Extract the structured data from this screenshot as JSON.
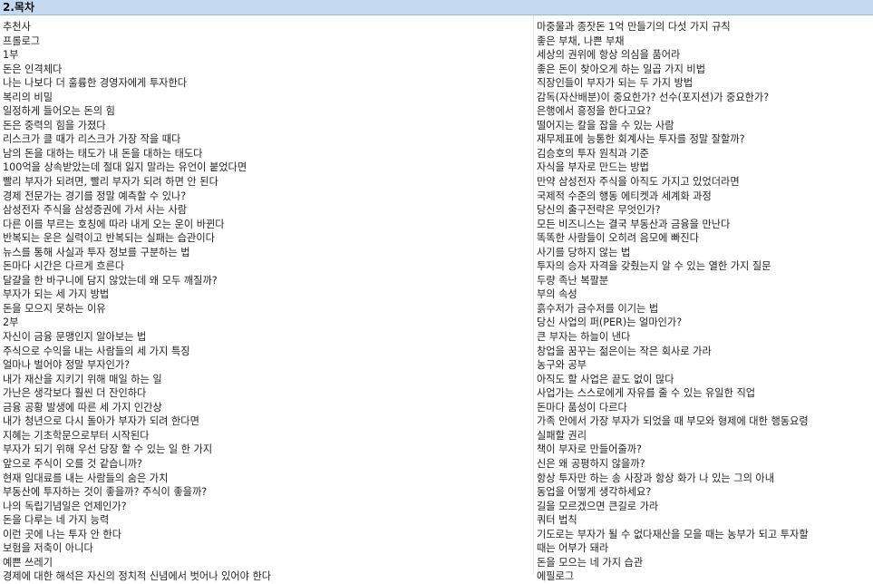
{
  "header": {
    "title": "2.목차"
  },
  "left_items": [
    "추천사",
    "프롤로그",
    "1부",
    "돈은 인격체다",
    "나는 나보다 더 훌륭한 경영자에게 투자한다",
    "복리의 비밀",
    "일정하게 들어오는 돈의 힘",
    "돈은 중력의 힘을 가졌다",
    "리스크가 클 때가 리스크가 가장 작을 때다",
    "남의 돈을 대하는 태도가 내 돈을 대하는 태도다",
    "100억을 상속받았는데 절대 잃지 말라는 유언이 붙었다면",
    "빨리 부자가 되려면, 빨리 부자가 되려 하면 안 된다",
    "경제 전문가는 경기를 정말 예측할 수 있나?",
    "삼성전자 주식을 삼성증권에 가서 사는 사람",
    "다른 이를 부르는 호칭에 따라 내게 오는 운이 바뀐다",
    "반복되는 운은 실력이고 반복되는 실패는 습관이다",
    "뉴스를 통해 사실과 투자 정보를 구분하는 법",
    "돈마다 시간은 다르게 흐른다",
    "달걀을 한 바구니에 담지 않았는데 왜 모두 깨질까?",
    "부자가 되는 세 가지 방법",
    "돈을 모으지 못하는 이유",
    "2부",
    "자신이 금융 문맹인지 알아보는 법",
    "주식으로 수익을 내는 사람들의 세 가지 특징",
    "얼마나 벌어야 정말 부자인가?",
    "내가 재산을 지키기 위해 매일 하는 일",
    "가난은 생각보다 훨씬 더 잔인하다",
    "금융 공황 발생에 따른 세 가지 인간상",
    "내가 청년으로 다시 돌아가 부자가 되려 한다면",
    "지혜는 기초학문으로부터 시작된다",
    "부자가 되기 위해 우선 당장 할 수 있는 일 한 가지",
    "앞으로 주식이 오를 것 같습니까?",
    "현재 임대료를 내는 사람들의 숨은 가치",
    "부동산에 투자하는 것이 좋을까? 주식이 좋을까?",
    "나의 독립기념일은 언제인가?",
    "돈을 다루는 네 가지 능력",
    "이런 곳에 나는 투자 안 한다",
    "보험을 저축이 아니다",
    "예쁜 쓰레기",
    "경제에 대한 해석은 자신의 정치적 신념에서 벗어나 있어야 한다"
  ],
  "right_items": [
    "마중물과 종잣돈 1억 만들기의 다섯 가지 규칙",
    "좋은 부채, 나쁜 부채",
    "세상의 권위에 항상 의심을 품어라",
    "좋은 돈이 찾아오게 하는 일곱 가지 비법",
    "직장인들이 부자가 되는 두 가지 방법",
    "감독(자산배분)이 중요한가? 선수(포지션)가 중요한가?",
    "은행에서 흥정을 한다고요?",
    "떨어지는 칼을 잡을 수 있는 사람",
    "재무제표에 능통한 회계사는 투자를 정말 잘할까?",
    "김승호의 투자 원칙과 기준",
    "자식을 부자로 만드는 방법",
    "만약 삼성전자 주식을 아직도 가지고 있었더라면",
    "국제적 수준의 행동 에티켓과 세계화 과정",
    "당신의 출구전략은 무엇인가?",
    "모든 비즈니스는 결국 부동산과 금융을 만난다",
    "똑똑한 사람들이 오히려 음모에 빠진다",
    "사기를 당하지 않는 법",
    "투자의 승자 자격을 갖췄는지 알 수 있는 열한 가지 질문",
    "두량 족난 복팔분",
    "부의 속성",
    "흙수저가 금수저를 이기는 법",
    "당신 사업의 퍼(PER)는 얼마인가?",
    "큰 부자는 하늘이 낸다",
    "창업을 꿈꾸는 젊은이는 작은 회사로 가라",
    "농구와 공부",
    "아직도 할 사업은 끝도 없이 많다",
    "사업가는 스스로에게 자유를 줄 수 있는 유일한 직업",
    "돈마다 품성이 다르다",
    "가족 안에서 가장 부자가 되었을 때 부모와 형제에 대한 행동요령",
    "실패할 권리",
    "책이 부자로 만들어줄까?",
    "신은 왜 공평하지 않을까?",
    "항상 투자만 하는 송 사장과 항상 화가 나 있는 그의 아내",
    "동업을 어떻게 생각하세요?",
    "길을 모르겠으면 큰길로 가라",
    "쿼터 법칙",
    "기도로는 부자가 될 수 없다재산을 모을 때는 농부가 되고 투자할",
    "때는 어부가 돼라",
    "돈을 모으는 네 가지 습관",
    "에필로그"
  ]
}
